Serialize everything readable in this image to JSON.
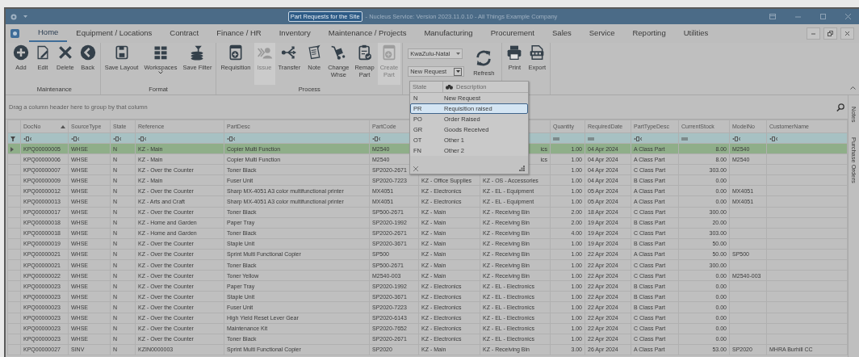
{
  "window": {
    "title": "Part Requests for the Site",
    "subtitle": "- Nucleus Service: Version 2023.11.0.10 - All Things Example Company"
  },
  "menu": [
    {
      "label": "Home",
      "selected": true
    },
    {
      "label": "Equipment / Locations",
      "selected": false
    },
    {
      "label": "Contract",
      "selected": false
    },
    {
      "label": "Finance / HR",
      "selected": false
    },
    {
      "label": "Inventory",
      "selected": false
    },
    {
      "label": "Maintenance / Projects",
      "selected": false
    },
    {
      "label": "Manufacturing",
      "selected": false
    },
    {
      "label": "Procurement",
      "selected": false
    },
    {
      "label": "Sales",
      "selected": false
    },
    {
      "label": "Service",
      "selected": false
    },
    {
      "label": "Reporting",
      "selected": false
    },
    {
      "label": "Utilities",
      "selected": false
    }
  ],
  "ribbon": [
    {
      "kind": "buttons",
      "label": "Maintenance",
      "buttons": [
        {
          "label": "Add",
          "disabled": false,
          "menu": false
        },
        {
          "label": "Edit",
          "disabled": false,
          "menu": false
        },
        {
          "label": "Delete",
          "disabled": false,
          "menu": false
        },
        {
          "label": "Back",
          "disabled": false,
          "menu": false
        }
      ]
    },
    {
      "kind": "buttons",
      "label": "Format",
      "buttons": [
        {
          "label": "Save Layout",
          "disabled": false,
          "menu": false
        },
        {
          "label": "Workspaces",
          "disabled": false,
          "menu": true
        },
        {
          "label": "Save Filter",
          "disabled": false,
          "menu": false
        }
      ]
    },
    {
      "kind": "buttons",
      "label": "Process",
      "buttons": [
        {
          "label": "Requisition",
          "disabled": false,
          "menu": false
        },
        {
          "label": "Issue",
          "disabled": true,
          "menu": false
        },
        {
          "label": "Transfer",
          "disabled": false,
          "menu": false
        },
        {
          "label": "Note",
          "disabled": false,
          "menu": false
        },
        {
          "label": "Change Whse",
          "disabled": false,
          "menu": false
        },
        {
          "label": "Remap Part",
          "disabled": false,
          "menu": false
        },
        {
          "label": "Create Part",
          "disabled": true,
          "menu": false
        }
      ]
    },
    {
      "kind": "filters",
      "site": "KwaZulu-Natal",
      "state": "New Request",
      "refresh": "Refresh"
    },
    {
      "kind": "buttons",
      "buttons": [
        {
          "label": "Print",
          "disabled": false,
          "menu": false
        },
        {
          "label": "Export",
          "disabled": false,
          "menu": false
        }
      ]
    }
  ],
  "state_dropdown": {
    "columns": [
      "State",
      "Description"
    ],
    "items": [
      {
        "code": "N",
        "description": "New Request",
        "selected": false
      },
      {
        "code": "PR",
        "description": "Requisition raised",
        "selected": true
      },
      {
        "code": "PO",
        "description": "Order Raised",
        "selected": false
      },
      {
        "code": "GR",
        "description": "Goods Received",
        "selected": false
      },
      {
        "code": "OT",
        "description": "Other 1",
        "selected": false
      },
      {
        "code": "FN",
        "description": "Other 2",
        "selected": false
      }
    ]
  },
  "grid": {
    "group_panel": "Drag a column header here to group by that column",
    "columns": [
      {
        "label": "DocNo",
        "kind": "text",
        "sorted": true
      },
      {
        "label": "SourceType",
        "kind": "text",
        "sorted": false
      },
      {
        "label": "State",
        "kind": "text",
        "sorted": false
      },
      {
        "label": "Reference",
        "kind": "text",
        "sorted": false
      },
      {
        "label": "PartDesc",
        "kind": "text",
        "sorted": false
      },
      {
        "label": "PartCode",
        "kind": "text"
      },
      {},
      {},
      {
        "label": "Quantity",
        "kind": "number",
        "sorted": false
      },
      {
        "label": "RequiredDate",
        "kind": "date",
        "sorted": false
      },
      {
        "label": "PartTypeDesc",
        "kind": "text",
        "sorted": false
      },
      {
        "label": "CurrentStock",
        "kind": "number",
        "sorted": false
      },
      {
        "label": "ModelNo",
        "kind": "text",
        "sorted": false
      },
      {
        "label": "CustomerName",
        "kind": "text",
        "sorted": false
      }
    ],
    "rows": [
      {
        "selected": true,
        "covered": true,
        "cells": [
          "KPQ00000005",
          "WHSE",
          "N",
          "KZ - Main",
          "Copier Multi Function",
          "M2540",
          null,
          "ics",
          "1.00",
          "04 Apr 2024",
          "A Class Part",
          "8.00",
          "M2540",
          null
        ]
      },
      {
        "selected": false,
        "covered": true,
        "cells": [
          "KPQ00000006",
          "WHSE",
          "N",
          "KZ - Main",
          "Copier Multi Function",
          "M2540",
          null,
          "ics",
          "1.00",
          "04 Apr 2024",
          "A Class Part",
          "8.00",
          "M2540",
          null
        ]
      },
      {
        "selected": false,
        "cells": [
          "KPQ00000007",
          "WHSE",
          "N",
          "KZ - Over the Counter",
          "Toner Black",
          "SP2020-2671",
          null,
          null,
          "1.00",
          "04 Apr 2024",
          "C Class Part",
          "303.00",
          null,
          null
        ]
      },
      {
        "selected": false,
        "covered": false,
        "cells": [
          "KPQ00000009",
          "WHSE",
          "N",
          "KZ - Main",
          "Fuser Unit",
          "SP2020-7223",
          "KZ - Office Supplies",
          "KZ - OS - Accessories",
          "1.00",
          "04 Apr 2024",
          "B Class Part",
          "0.00",
          null,
          null
        ]
      },
      {
        "selected": false,
        "covered": false,
        "cells": [
          "KPQ00000012",
          "WHSE",
          "N",
          "KZ - Over the Counter",
          "Sharp MX-4051 A3 color multifunctional printer",
          "MX4051",
          "KZ - Electronics",
          "KZ - EL - Equipment",
          "1.00",
          "05 Apr 2024",
          "A Class Part",
          "0.00",
          "MX4051",
          null
        ]
      },
      {
        "selected": false,
        "covered": false,
        "cells": [
          "KPQ00000013",
          "WHSE",
          "N",
          "KZ - Arts and Craft",
          "Sharp MX-4051 A3 color multifunctional printer",
          "MX4051",
          "KZ - Electronics",
          "KZ - EL - Equipment",
          "1.00",
          "05 Apr 2024",
          "A Class Part",
          "0.00",
          "MX4051",
          null
        ]
      },
      {
        "selected": false,
        "covered": false,
        "cells": [
          "KPQ00000017",
          "WHSE",
          "N",
          "KZ - Over the Counter",
          "Toner Black",
          "SP500-2671",
          "KZ - Main",
          "KZ - Receiving Bin",
          "2.00",
          "18 Apr 2024",
          "C Class Part",
          "300.00",
          null,
          null
        ]
      },
      {
        "selected": false,
        "covered": false,
        "cells": [
          "KPQ00000018",
          "WHSE",
          "N",
          "KZ - Home and Garden",
          "Paper Tray",
          "SP2020-1992",
          "KZ - Main",
          "KZ - Receiving Bin",
          "2.00",
          "19 Apr 2024",
          "B Class Part",
          "20.00",
          null,
          null
        ]
      },
      {
        "selected": false,
        "covered": false,
        "cells": [
          "KPQ00000018",
          "WHSE",
          "N",
          "KZ - Home and Garden",
          "Toner Black",
          "SP2020-2671",
          "KZ - Main",
          "KZ - Receiving Bin",
          "4.00",
          "19 Apr 2024",
          "C Class Part",
          "303.00",
          null,
          null
        ]
      },
      {
        "selected": false,
        "covered": false,
        "cells": [
          "KPQ00000019",
          "WHSE",
          "N",
          "KZ - Over the Counter",
          "Staple Unit",
          "SP2020-3671",
          "KZ - Main",
          "KZ - Receiving Bin",
          "1.00",
          "19 Apr 2024",
          "B Class Part",
          "50.00",
          null,
          null
        ]
      },
      {
        "selected": false,
        "covered": false,
        "cells": [
          "KPQ00000021",
          "WHSE",
          "N",
          "KZ - Over the Counter",
          "Sprint Multi Functional Copier",
          "SP500",
          "KZ - Main",
          "KZ - Receiving Bin",
          "1.00",
          "22 Apr 2024",
          "A Class Part",
          "50.00",
          "SP500",
          null
        ]
      },
      {
        "selected": false,
        "covered": false,
        "cells": [
          "KPQ00000021",
          "WHSE",
          "N",
          "KZ - Over the Counter",
          "Toner Black",
          "SP500-2671",
          "KZ - Main",
          "KZ - Receiving Bin",
          "1.00",
          "22 Apr 2024",
          "C Class Part",
          "300.00",
          null,
          null
        ]
      },
      {
        "selected": false,
        "covered": false,
        "cells": [
          "KPQ00000022",
          "WHSE",
          "N",
          "KZ - Over the Counter",
          "Toner Yellow",
          "M2540-003",
          "KZ - Main",
          "KZ - Receiving Bin",
          "1.00",
          "22 Apr 2024",
          "C Class Part",
          "0.00",
          "M2540-003",
          null
        ]
      },
      {
        "selected": false,
        "covered": false,
        "cells": [
          "KPQ00000023",
          "WHSE",
          "N",
          "KZ - Over the Counter",
          "Paper Tray",
          "SP2020-1992",
          "KZ - Electronics",
          "KZ - EL - Electronics",
          "1.00",
          "22 Apr 2024",
          "B Class Part",
          "0.00",
          null,
          null
        ]
      },
      {
        "selected": false,
        "covered": false,
        "cells": [
          "KPQ00000023",
          "WHSE",
          "N",
          "KZ - Over the Counter",
          "Staple Unit",
          "SP2020-3671",
          "KZ - Electronics",
          "KZ - EL - Electronics",
          "1.00",
          "22 Apr 2024",
          "B Class Part",
          "0.00",
          null,
          null
        ]
      },
      {
        "selected": false,
        "covered": false,
        "cells": [
          "KPQ00000023",
          "WHSE",
          "N",
          "KZ - Over the Counter",
          "Fuser Unit",
          "SP2020-7223",
          "KZ - Electronics",
          "KZ - EL - Electronics",
          "1.00",
          "22 Apr 2024",
          "B Class Part",
          "0.00",
          null,
          null
        ]
      },
      {
        "selected": false,
        "covered": false,
        "cells": [
          "KPQ00000023",
          "WHSE",
          "N",
          "KZ - Over the Counter",
          "High Yield Reset Lever Gear",
          "SP2020-6143",
          "KZ - Electronics",
          "KZ - EL - Electronics",
          "1.00",
          "22 Apr 2024",
          "C Class Part",
          "0.00",
          null,
          null
        ]
      },
      {
        "selected": false,
        "covered": false,
        "cells": [
          "KPQ00000023",
          "WHSE",
          "N",
          "KZ - Over the Counter",
          "Maintenance Kit",
          "SP2020-7652",
          "KZ - Electronics",
          "KZ - EL - Electronics",
          "1.00",
          "22 Apr 2024",
          "C Class Part",
          "0.00",
          null,
          null
        ]
      },
      {
        "selected": false,
        "covered": false,
        "cells": [
          "KPQ00000023",
          "WHSE",
          "N",
          "KZ - Over the Counter",
          "Toner Black",
          "SP2020-2671",
          "KZ - Electronics",
          "KZ - EL - Electronics",
          "1.00",
          "22 Apr 2024",
          "C Class Part",
          "0.00",
          null,
          null
        ]
      },
      {
        "selected": false,
        "covered": false,
        "cells": [
          "KPQ00000027",
          "SINV",
          "N",
          "KZIN0000003",
          "Sprint Multi Functional Copier",
          "SP2020",
          "KZ - Main",
          "KZ - Receiving Bin",
          "3.00",
          "26 Apr 2024",
          "A Class Part",
          "53.00",
          "SP2020",
          "MHRA Burhill CC"
        ]
      }
    ]
  },
  "side_tabs": [
    "Notes",
    "Purchase Orders"
  ]
}
